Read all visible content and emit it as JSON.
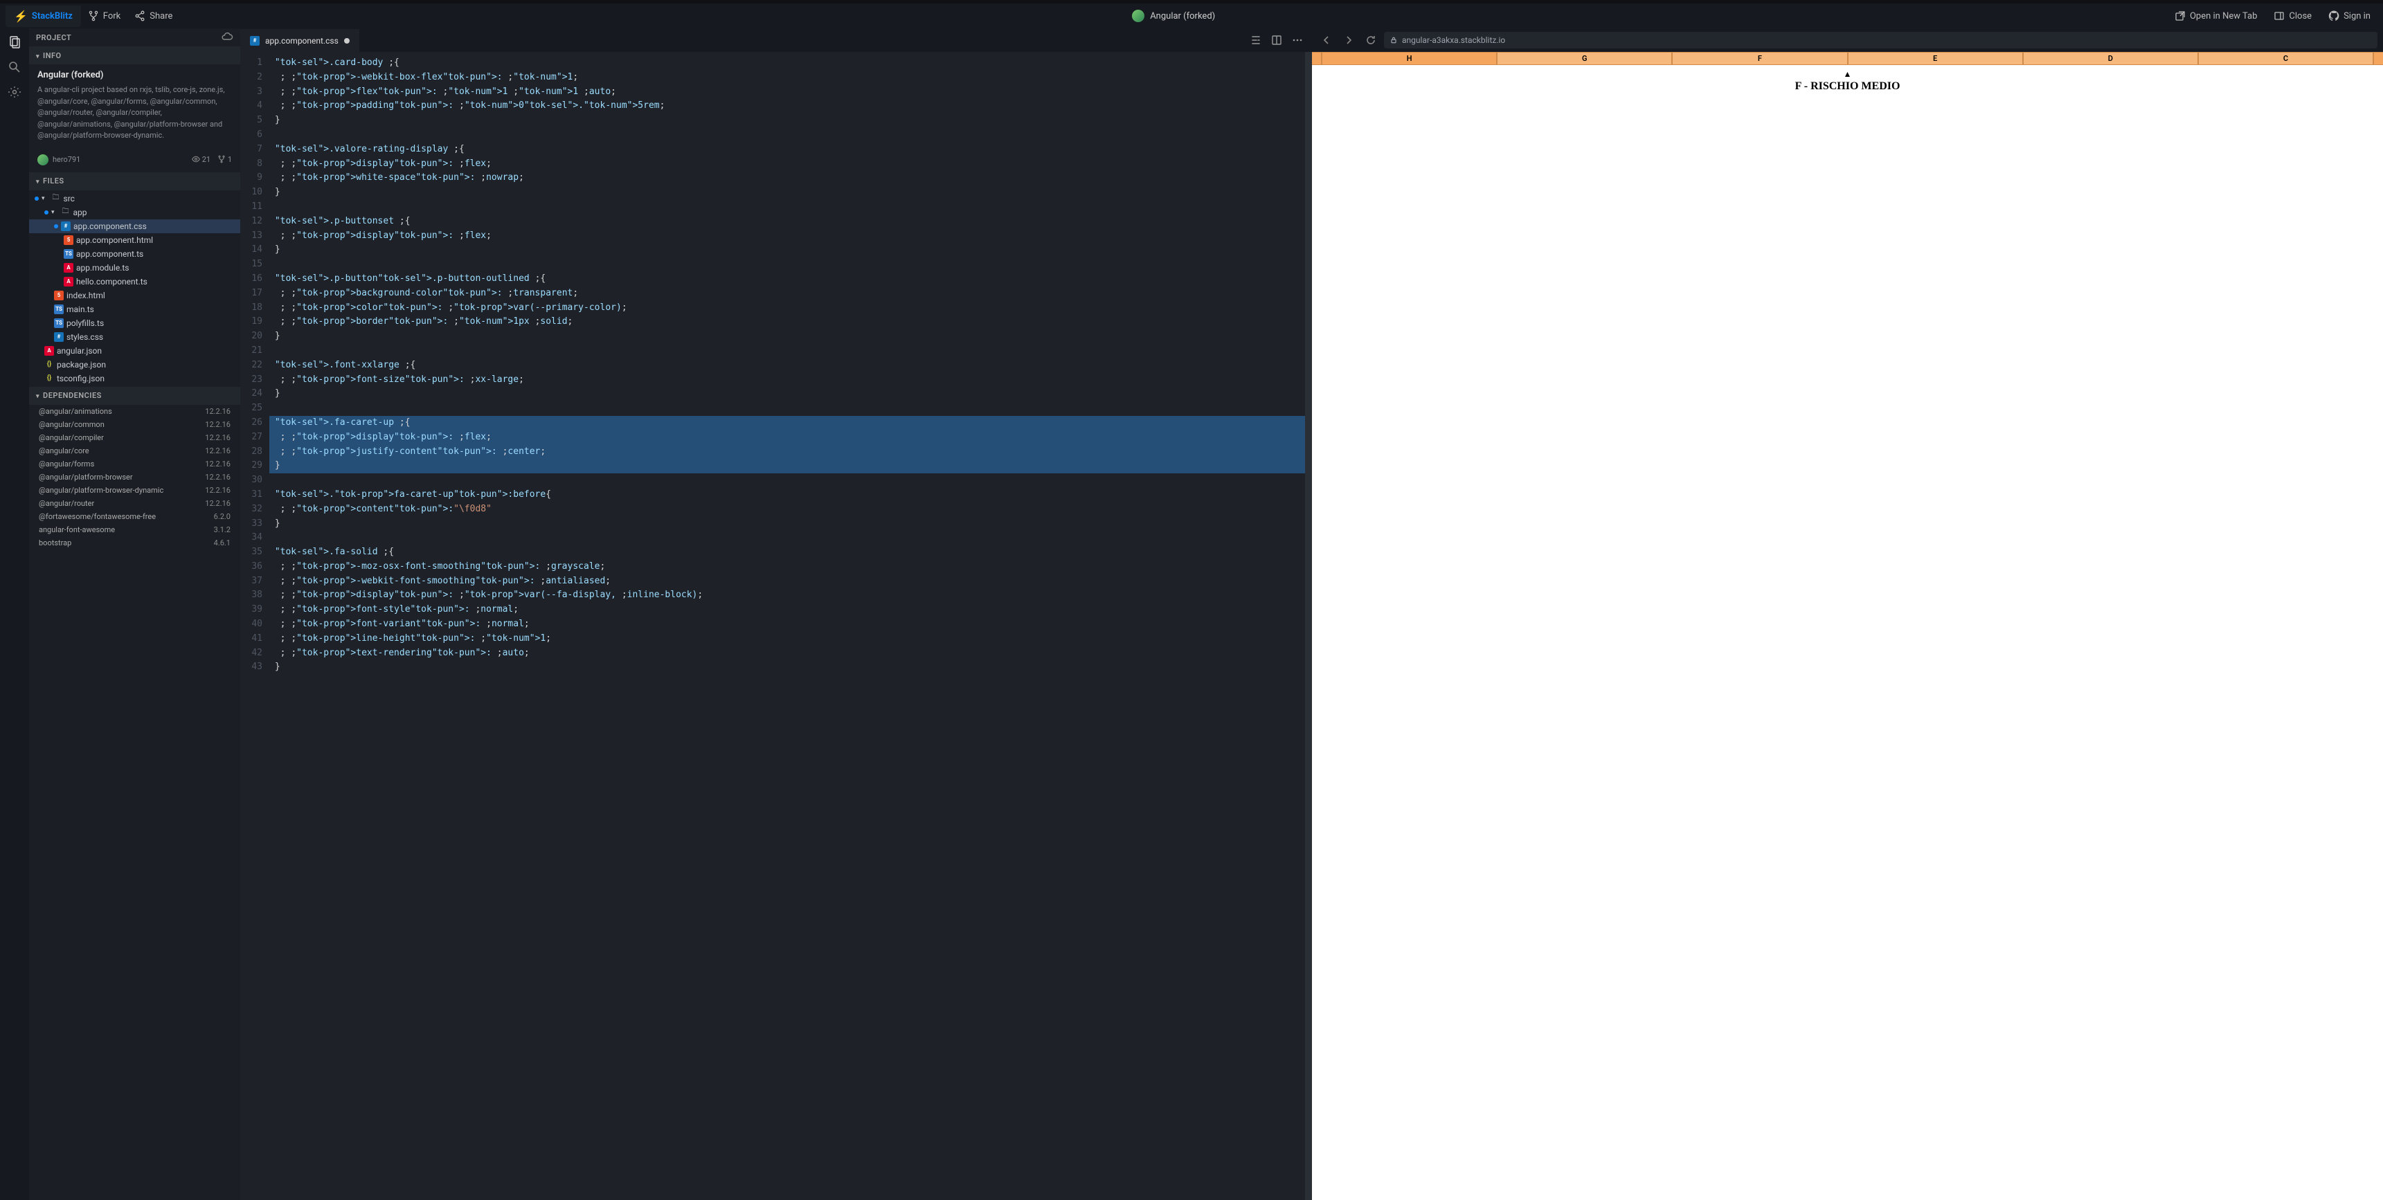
{
  "header": {
    "logo": "StackBlitz",
    "fork": "Fork",
    "share": "Share",
    "title": "Angular (forked)",
    "open_new_tab": "Open in New Tab",
    "close": "Close",
    "sign_in": "Sign in"
  },
  "sidebar": {
    "project_label": "PROJECT",
    "info_label": "INFO",
    "project_title": "Angular (forked)",
    "project_desc": "A angular-cli project based on rxjs, tslib, core-js, zone.js, @angular/core, @angular/forms, @angular/common, @angular/router, @angular/compiler, @angular/animations, @angular/platform-browser and @angular/platform-browser-dynamic.",
    "owner": "hero791",
    "views": "21",
    "forks": "1",
    "files_label": "FILES",
    "deps_label": "DEPENDENCIES"
  },
  "tree": {
    "src": "src",
    "app": "app",
    "files": {
      "app_component_css": "app.component.css",
      "app_component_html": "app.component.html",
      "app_component_ts": "app.component.ts",
      "app_module_ts": "app.module.ts",
      "hello_component_ts": "hello.component.ts",
      "index_html": "index.html",
      "main_ts": "main.ts",
      "polyfills_ts": "polyfills.ts",
      "styles_css": "styles.css",
      "angular_json": "angular.json",
      "package_json": "package.json",
      "tsconfig_json": "tsconfig.json"
    }
  },
  "dependencies": [
    {
      "name": "@angular/animations",
      "version": "12.2.16"
    },
    {
      "name": "@angular/common",
      "version": "12.2.16"
    },
    {
      "name": "@angular/compiler",
      "version": "12.2.16"
    },
    {
      "name": "@angular/core",
      "version": "12.2.16"
    },
    {
      "name": "@angular/forms",
      "version": "12.2.16"
    },
    {
      "name": "@angular/platform-browser",
      "version": "12.2.16"
    },
    {
      "name": "@angular/platform-browser-dynamic",
      "version": "12.2.16"
    },
    {
      "name": "@angular/router",
      "version": "12.2.16"
    },
    {
      "name": "@fortawesome/fontawesome-free",
      "version": "6.2.0"
    },
    {
      "name": "angular-font-awesome",
      "version": "3.1.2"
    },
    {
      "name": "bootstrap",
      "version": "4.6.1"
    }
  ],
  "tab": {
    "name": "app.component.css"
  },
  "code_lines": [
    ".card-body {",
    "  -webkit-box-flex: 1;",
    "  flex: 1 1 auto;",
    "  padding: 0.5rem;",
    "}",
    "",
    ".valore-rating-display {",
    "  display: flex;",
    "  white-space: nowrap;",
    "}",
    "",
    ".p-buttonset {",
    "  display: flex;",
    "}",
    "",
    ".p-button.p-button-outlined {",
    "  background-color: transparent;",
    "  color: var(--primary-color);",
    "  border: 1px solid;",
    "}",
    "",
    ".font-xxlarge {",
    "  font-size: xx-large;",
    "}",
    "",
    ".fa-caret-up {",
    "  display: flex;",
    "  justify-content: center;",
    "}",
    "",
    ".fa-caret-up:before{",
    "  content:\"\\f0d8\"",
    "}",
    "",
    ".fa-solid {",
    "  -moz-osx-font-smoothing: grayscale;",
    "  -webkit-font-smoothing: antialiased;",
    "  display: var(--fa-display, inline-block);",
    "  font-style: normal;",
    "  font-variant: normal;",
    "  line-height: 1;",
    "  text-rendering: auto;",
    "}"
  ],
  "highlighted_lines": [
    26,
    27,
    28,
    29
  ],
  "preview": {
    "url": "angular-a3akxa.stackblitz.io",
    "risk_headers": [
      "",
      "H",
      "G",
      "F",
      "E",
      "D",
      "C",
      ""
    ],
    "risk_label": "F - RISCHIO MEDIO"
  }
}
